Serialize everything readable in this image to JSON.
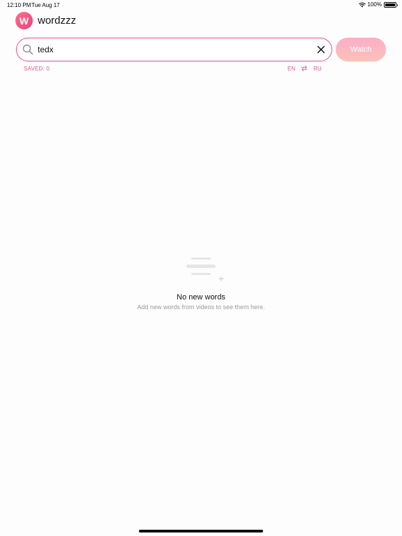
{
  "status_bar": {
    "time": "12:10 PM",
    "date": "Tue Aug 17",
    "battery": "100%",
    "icons": [
      "wifi-icon",
      "battery-icon"
    ]
  },
  "header": {
    "logo_letter": "W",
    "title": "wordzzz"
  },
  "search": {
    "value": "tedx",
    "icon": "search-icon",
    "clear_icon": "close-icon"
  },
  "watch_button": {
    "label": "Watch"
  },
  "saved": {
    "label": "SAVED: 0"
  },
  "language": {
    "from": "EN",
    "to": "RU",
    "swap_icon": "swap-arrows-icon"
  },
  "empty_state": {
    "icon": "add-list-icon",
    "title": "No new words",
    "subtitle": "Add new words from videos to see them here."
  },
  "colors": {
    "accent": "#ec4d8c",
    "label_pink": "#e0589a",
    "watch_gradient_start": "#fbaec8",
    "watch_gradient_end": "#fdc1b8",
    "muted_text": "#9a9a9a"
  }
}
